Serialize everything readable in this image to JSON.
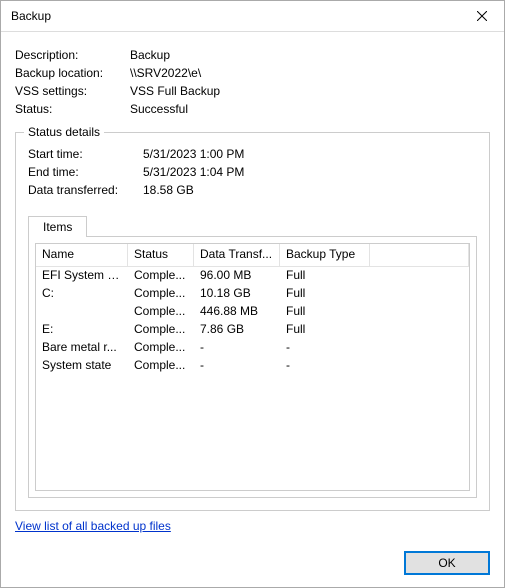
{
  "window": {
    "title": "Backup"
  },
  "fields": {
    "description_label": "Description:",
    "description_value": "Backup",
    "location_label": "Backup location:",
    "location_value": "\\\\SRV2022\\e\\",
    "vss_label": "VSS settings:",
    "vss_value": "VSS Full Backup",
    "status_label": "Status:",
    "status_value": "Successful"
  },
  "details": {
    "legend": "Status details",
    "start_label": "Start time:",
    "start_value": "5/31/2023 1:00 PM",
    "end_label": "End time:",
    "end_value": "5/31/2023 1:04 PM",
    "dt_label": "Data transferred:",
    "dt_value": "18.58 GB"
  },
  "tab": {
    "items_label": "Items"
  },
  "table": {
    "headers": {
      "name": "Name",
      "status": "Status",
      "dt": "Data Transf...",
      "bt": "Backup Type"
    },
    "rows": [
      {
        "name": "EFI System P...",
        "status": "Comple...",
        "dt": "96.00 MB",
        "bt": "Full"
      },
      {
        "name": "C:",
        "status": "Comple...",
        "dt": "10.18 GB",
        "bt": "Full"
      },
      {
        "name": "",
        "status": "Comple...",
        "dt": "446.88 MB",
        "bt": "Full"
      },
      {
        "name": "E:",
        "status": "Comple...",
        "dt": "7.86 GB",
        "bt": "Full"
      },
      {
        "name": "Bare metal r...",
        "status": "Comple...",
        "dt": "-",
        "bt": "-"
      },
      {
        "name": "System state",
        "status": "Comple...",
        "dt": "-",
        "bt": "-"
      }
    ]
  },
  "link_label": "View list of all backed up files",
  "ok_label": "OK"
}
